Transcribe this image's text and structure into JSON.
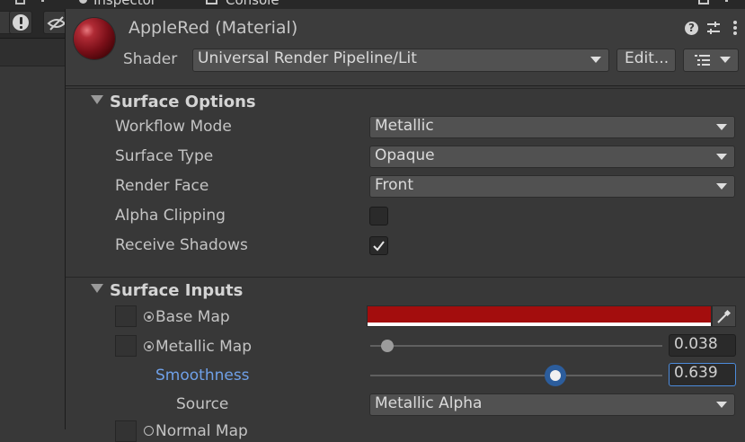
{
  "tabs": [
    {
      "label": "Inspector",
      "icon": "info-icon"
    },
    {
      "label": "Console",
      "icon": "console-icon"
    }
  ],
  "material": {
    "title": "AppleRed (Material)",
    "shader_label": "Shader",
    "shader_value": "Universal Render Pipeline/Lit",
    "edit_label": "Edit..."
  },
  "surface_options": {
    "title": "Surface Options",
    "workflow_mode": {
      "label": "Workflow Mode",
      "value": "Metallic"
    },
    "surface_type": {
      "label": "Surface Type",
      "value": "Opaque"
    },
    "render_face": {
      "label": "Render Face",
      "value": "Front"
    },
    "alpha_clipping": {
      "label": "Alpha Clipping",
      "checked": false
    },
    "receive_shadows": {
      "label": "Receive Shadows",
      "checked": true
    }
  },
  "surface_inputs": {
    "title": "Surface Inputs",
    "base_map": {
      "label": "Base Map",
      "color": "#a30d0d"
    },
    "metallic_map": {
      "label": "Metallic Map",
      "value": "0.038",
      "fraction": 0.038
    },
    "smoothness": {
      "label": "Smoothness",
      "value": "0.639",
      "fraction": 0.639,
      "color": "#6fa0e8"
    },
    "source": {
      "label": "Source",
      "value": "Metallic Alpha"
    },
    "normal_map": {
      "label": "Normal Map"
    }
  }
}
